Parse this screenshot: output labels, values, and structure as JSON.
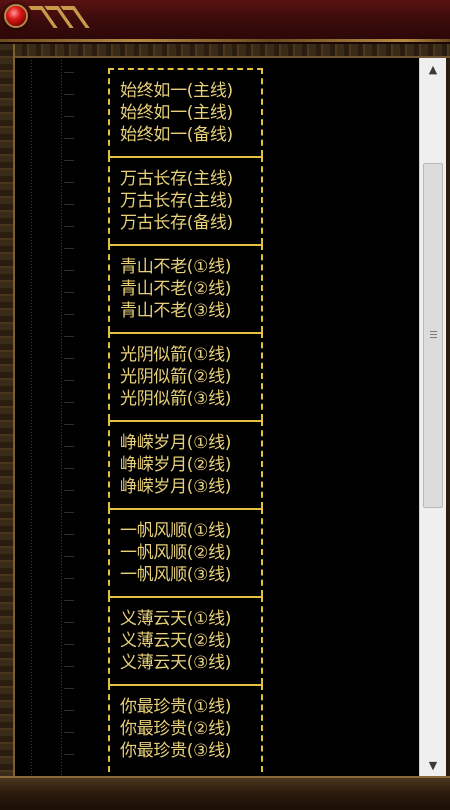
{
  "colors": {
    "text": "#e8d07a",
    "border": "#e6c040",
    "background": "#000000",
    "frame_red": "#5a1212",
    "frame_gold": "#b68a3f"
  },
  "scrollbar": {
    "up_icon": "▲",
    "down_icon": "▼",
    "position": 0.12
  },
  "groups": [
    {
      "lines": [
        "始终如一(主线)",
        "始终如一(主线)",
        "始终如一(备线)"
      ]
    },
    {
      "lines": [
        "万古长存(主线)",
        "万古长存(主线)",
        "万古长存(备线)"
      ]
    },
    {
      "lines": [
        "青山不老(①线)",
        "青山不老(②线)",
        "青山不老(③线)"
      ]
    },
    {
      "lines": [
        "光阴似箭(①线)",
        "光阴似箭(②线)",
        "光阴似箭(③线)"
      ]
    },
    {
      "lines": [
        "峥嵘岁月(①线)",
        "峥嵘岁月(②线)",
        "峥嵘岁月(③线)"
      ]
    },
    {
      "lines": [
        "一帆风顺(①线)",
        "一帆风顺(②线)",
        "一帆风顺(③线)"
      ]
    },
    {
      "lines": [
        "义薄云天(①线)",
        "义薄云天(②线)",
        "义薄云天(③线)"
      ]
    },
    {
      "lines": [
        "你最珍贵(①线)",
        "你最珍贵(②线)",
        "你最珍贵(③线)"
      ]
    }
  ]
}
